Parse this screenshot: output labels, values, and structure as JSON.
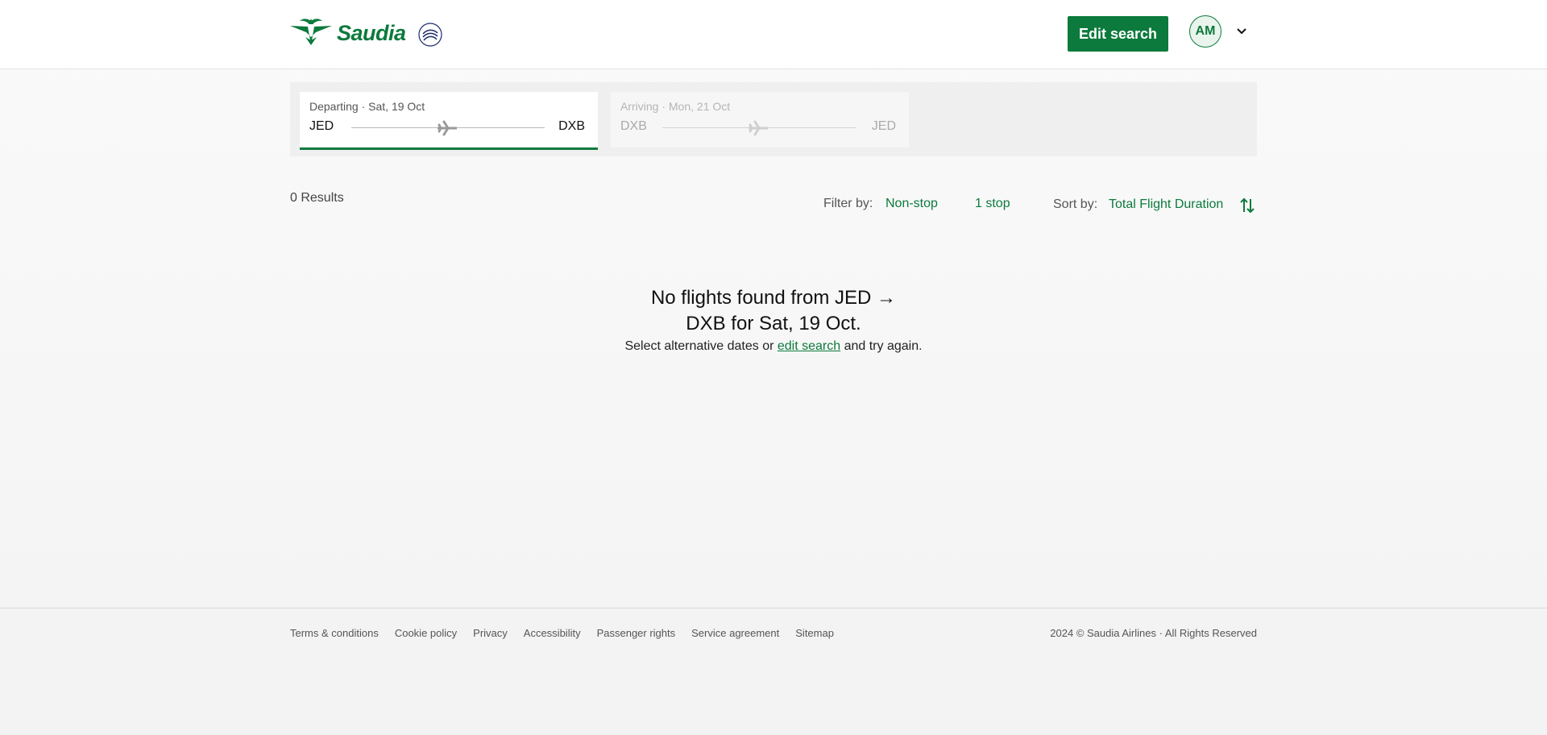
{
  "header": {
    "brand": "Saudia",
    "edit_search_label": "Edit search",
    "avatar_initials": "AM"
  },
  "journey_tabs": [
    {
      "date": "Departing · Sat, 19 Oct",
      "from": "JED",
      "to": "DXB",
      "active": true
    },
    {
      "date": "Arriving · Mon, 21 Oct",
      "from": "DXB",
      "to": "JED",
      "active": false
    }
  ],
  "results": {
    "count_label": "0 Results",
    "filter_label": "Filter by:",
    "filters": [
      "Non-stop",
      "1 stop"
    ],
    "sort_label": "Sort by:",
    "sort_value": "Total Flight Duration"
  },
  "empty_state": {
    "title": "No flights found from JED → DXB for Sat, 19 Oct.",
    "subtitle_prefix": "Select alternative dates or ",
    "subtitle_link": "edit search",
    "subtitle_suffix": " and try again."
  },
  "footer": {
    "links": [
      "Terms & conditions",
      "Cookie policy",
      "Privacy",
      "Accessibility",
      "Passenger rights",
      "Service agreement",
      "Sitemap"
    ],
    "copyright": "2024 © Saudia Airlines · All Rights Reserved"
  },
  "colors": {
    "brand_green": "#0c7a3c",
    "skyteam_navy": "#1d2a6b"
  }
}
